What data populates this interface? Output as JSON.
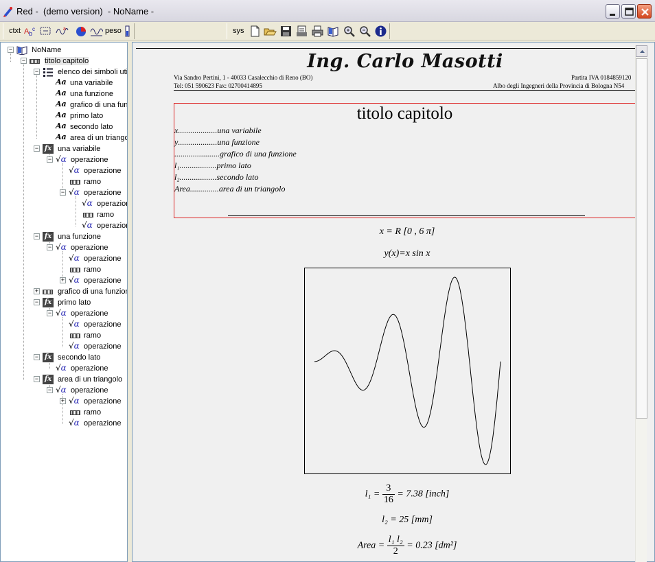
{
  "window": {
    "title": "Red -  (demo version)  - NoName -"
  },
  "toolbar": {
    "ctxt_label": "ctxt",
    "peso_label": "peso",
    "sys_label": "sys",
    "icons_left": [
      "abc-icon",
      "bracket-icon",
      "wave-alpha-icon",
      "pie-icon",
      "wave-icon"
    ],
    "icons_right": [
      "new-document-icon",
      "open-folder-icon",
      "save-icon",
      "print-preview-icon",
      "print-icon",
      "book-icon",
      "zoom-in-icon",
      "zoom-out-icon",
      "info-icon"
    ]
  },
  "tree": {
    "root": "NoName",
    "chapter": "titolo capitolo",
    "symbols_list": "elenco dei simboli utili",
    "symbols": [
      "una variabile",
      "una funzione",
      "grafico di una fun",
      "primo lato",
      "secondo lato",
      "area di un triango"
    ],
    "s1": "una variabile",
    "s2": "una funzione",
    "s3": "grafico di una funzion",
    "s4": "primo lato",
    "s5": "secondo lato",
    "s6": "area di un triangolo",
    "op": "operazione",
    "op_trunc": "operazior",
    "ramo": "ramo"
  },
  "document": {
    "company": "Ing. Carlo Masotti",
    "address": "Via Sandro Pertini, 1 - 40033  Casalecchio di Reno (BO)",
    "phone": "Tel: 051 590623 Fax: 02700414895",
    "vat": "Partita IVA 0184859120",
    "register": "Albo degli Ingegneri della Provincia di Bologna N54",
    "chapter_title": "titolo capitolo",
    "symbols": [
      {
        "sym": "x",
        "dots": "...................",
        "desc": "una variabile"
      },
      {
        "sym": "y",
        "dots": "...................",
        "desc": "una funzione"
      },
      {
        "sym": "",
        "dots": "......................",
        "desc": "grafico di una funzione"
      },
      {
        "sym": "l₁",
        "dots": "..................",
        "desc": "primo lato"
      },
      {
        "sym": "l₂",
        "dots": "..................",
        "desc": "secondo lato"
      },
      {
        "sym": "Area",
        "dots": "..............",
        "desc": "area di un triangolo"
      }
    ],
    "domain_formula": "x = R [0  ,  6   π]",
    "function_formula": "y(x)=x  sin  x",
    "l1_lhs": "l₁ =",
    "l1_num": "3",
    "l1_den": "16",
    "l1_rhs": "= 7.38 [inch]",
    "l2_formula": "l₂ = 25  [mm]",
    "area_lhs": "Area =",
    "area_num": "l₁  l₂",
    "area_den": "2",
    "area_rhs": "= 0.23 [dm²]"
  },
  "chart_data": {
    "type": "line",
    "function": "y = x sin x",
    "x_range": [
      0,
      18.85
    ],
    "series": [
      {
        "name": "",
        "formula": "x*sin(x)"
      }
    ],
    "grid": false
  }
}
